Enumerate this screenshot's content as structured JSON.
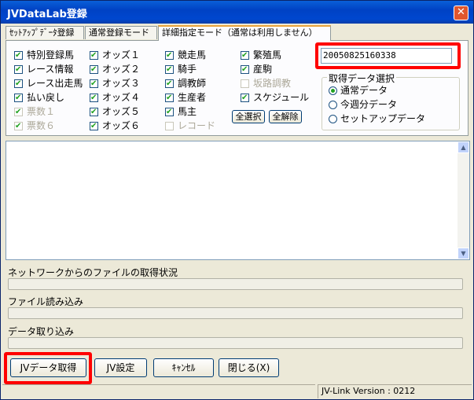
{
  "window": {
    "title": "JVDataLab登録",
    "close_glyph": "✕"
  },
  "tabs": [
    {
      "label": "ｾｯﾄｱｯﾌﾟﾃﾞｰﾀ登録"
    },
    {
      "label": "通常登録モード"
    },
    {
      "label": "詳細指定モード（通常は利用しません）"
    }
  ],
  "checkboxes": {
    "col1": [
      {
        "label": "特別登録馬",
        "checked": true,
        "enabled": true
      },
      {
        "label": "レース情報",
        "checked": true,
        "enabled": true
      },
      {
        "label": "レース出走馬",
        "checked": true,
        "enabled": true
      },
      {
        "label": "払い戻し",
        "checked": true,
        "enabled": true
      },
      {
        "label": "票数１",
        "checked": true,
        "enabled": false
      },
      {
        "label": "票数６",
        "checked": true,
        "enabled": false
      }
    ],
    "col2": [
      {
        "label": "オッズ１",
        "checked": true,
        "enabled": true
      },
      {
        "label": "オッズ２",
        "checked": true,
        "enabled": true
      },
      {
        "label": "オッズ３",
        "checked": true,
        "enabled": true
      },
      {
        "label": "オッズ４",
        "checked": true,
        "enabled": true
      },
      {
        "label": "オッズ５",
        "checked": true,
        "enabled": true
      },
      {
        "label": "オッズ６",
        "checked": true,
        "enabled": true
      }
    ],
    "col3": [
      {
        "label": "競走馬",
        "checked": true,
        "enabled": true
      },
      {
        "label": "騎手",
        "checked": true,
        "enabled": true
      },
      {
        "label": "調教師",
        "checked": true,
        "enabled": true
      },
      {
        "label": "生産者",
        "checked": true,
        "enabled": true
      },
      {
        "label": "馬主",
        "checked": true,
        "enabled": true
      },
      {
        "label": "レコード",
        "checked": false,
        "enabled": false
      }
    ],
    "col4": [
      {
        "label": "繁殖馬",
        "checked": true,
        "enabled": true
      },
      {
        "label": "産駒",
        "checked": true,
        "enabled": true
      },
      {
        "label": "坂路調教",
        "checked": false,
        "enabled": false
      },
      {
        "label": "スケジュール",
        "checked": true,
        "enabled": true
      }
    ]
  },
  "buttons": {
    "select_all": "全選択",
    "deselect_all": "全解除",
    "jv_get": "JVデータ取得",
    "jv_settings": "JV設定",
    "cancel": "ｷｬﾝｾﾙ",
    "close": "閉じる(X)"
  },
  "timestamp_field": {
    "value": "20050825160338"
  },
  "data_select": {
    "title": "取得データ選択",
    "options": [
      {
        "label": "通常データ",
        "selected": true
      },
      {
        "label": "今週分データ",
        "selected": false
      },
      {
        "label": "セットアップデータ",
        "selected": false
      }
    ]
  },
  "progress": {
    "network_label": "ネットワークからのファイルの取得状況",
    "read_label": "ファイル読み込み",
    "import_label": "データ取り込み"
  },
  "statusbar": {
    "version": "JV-Link Version : 0212"
  },
  "scroll": {
    "up_glyph": "▲",
    "down_glyph": "▼"
  }
}
